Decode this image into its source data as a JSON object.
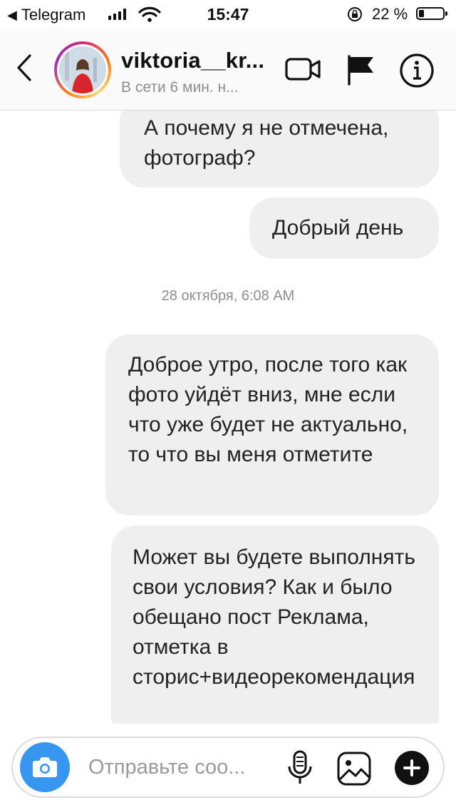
{
  "status_bar": {
    "back_app": "Telegram",
    "time": "15:47",
    "battery_percent": "22 %",
    "battery_level": 0.22,
    "icons": [
      "signal-icon",
      "wifi-icon",
      "orientation-lock-icon",
      "battery-icon"
    ]
  },
  "header": {
    "username": "viktoria__kr...",
    "status": "В сети 6 мин. н...",
    "icons": [
      "back-chevron-icon",
      "video-call-icon",
      "flag-icon",
      "info-icon"
    ],
    "story_ring_colors": [
      "#d62976",
      "#fa7e1e",
      "#feda75",
      "#962fbf"
    ]
  },
  "messages": [
    {
      "text": "А почему я не отмечена, фотограф?"
    },
    {
      "text": "Добрый день"
    },
    {
      "timestamp": "28 октября, 6:08 AM"
    },
    {
      "text": "Доброе утро, после того как фото уйдёт вниз, мне если что уже будет не актуально, то что вы меня отметите"
    },
    {
      "text": "Может вы будете выполнять свои условия? Как и было обещано пост Реклама, отметка в сторис+видеорекомендация"
    }
  ],
  "composer": {
    "placeholder": "Отправьте соо...",
    "icons": [
      "camera-icon",
      "microphone-icon",
      "gallery-icon",
      "plus-icon"
    ],
    "accent_color": "#3797f0"
  }
}
